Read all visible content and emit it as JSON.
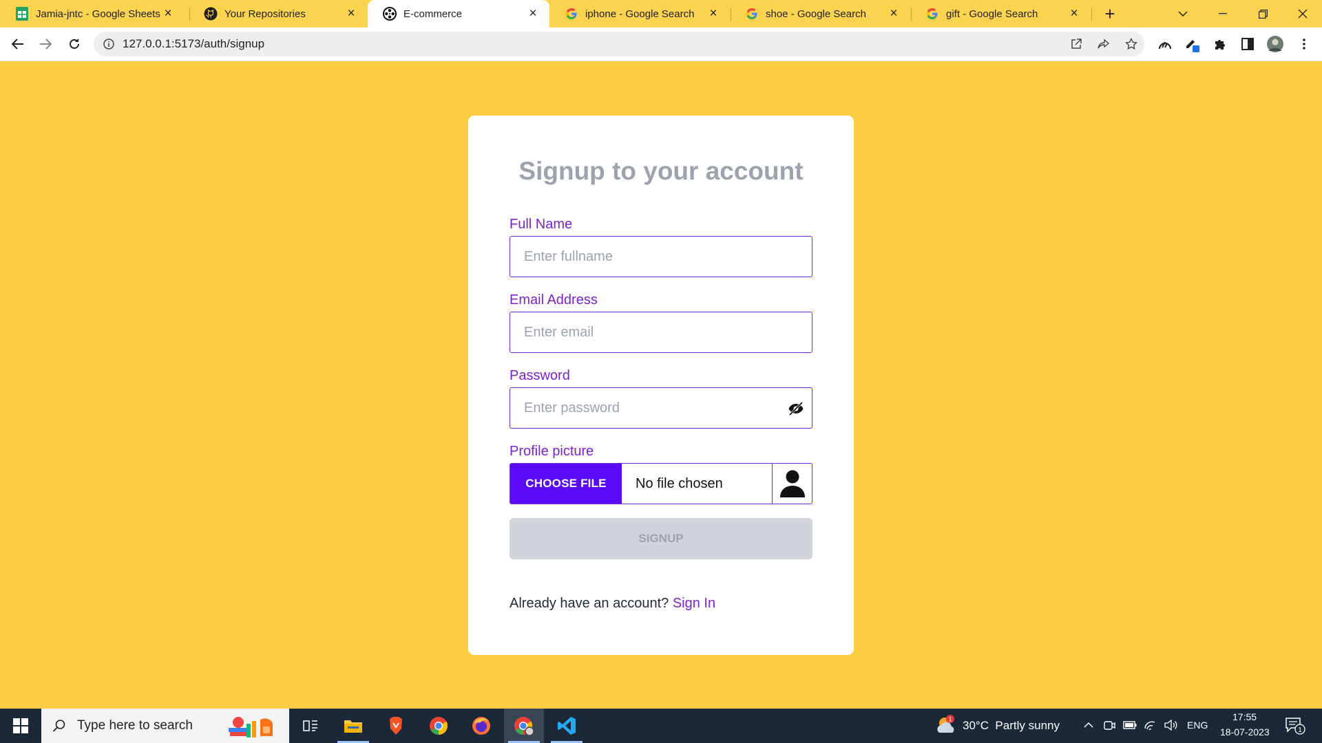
{
  "browser": {
    "tabs": [
      {
        "title": "Jamia-jntc - Google Sheets",
        "icon": "google-sheets-icon"
      },
      {
        "title": "Your Repositories",
        "icon": "github-icon"
      },
      {
        "title": "E-commerce",
        "icon": "film-reel-icon",
        "active": true
      },
      {
        "title": "iphone - Google Search",
        "icon": "google-icon"
      },
      {
        "title": "shoe - Google Search",
        "icon": "google-icon"
      },
      {
        "title": "gift - Google Search",
        "icon": "google-icon"
      }
    ],
    "url": "127.0.0.1:5173/auth/signup"
  },
  "signup": {
    "title": "Signup to your account",
    "fullname_label": "Full Name",
    "fullname_placeholder": "Enter fullname",
    "email_label": "Email Address",
    "email_placeholder": "Enter email",
    "password_label": "Password",
    "password_placeholder": "Enter password",
    "profile_label": "Profile picture",
    "choose_file": "CHOOSE FILE",
    "no_file": "No file chosen",
    "submit": "SIGNUP",
    "already_text": "Already have an account?",
    "signin_link": "Sign In"
  },
  "colors": {
    "page_bg": "#fdcd44",
    "accent": "#7e22ce",
    "file_button": "#5b0bf7",
    "disabled_button": "#d1d5db"
  },
  "taskbar": {
    "search_placeholder": "Type here to search",
    "weather": "30°C  Partly sunny",
    "weather_badge": "1",
    "language": "ENG",
    "time": "17:55",
    "date": "18-07-2023",
    "notifications": "1"
  }
}
